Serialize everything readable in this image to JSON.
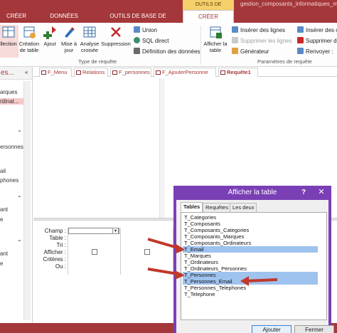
{
  "window": {
    "context_tab_header": "OUTILS DE REQUÊTE",
    "document_title": "gestion_composants_informatiques_ma"
  },
  "tabs": [
    {
      "label": "CRÉER"
    },
    {
      "label": "DONNÉES EXTERNES"
    },
    {
      "label": "OUTILS DE BASE DE DONNÉES"
    },
    {
      "label": "CRÉER"
    }
  ],
  "ribbon": {
    "buttons": [
      {
        "label": "llection"
      },
      {
        "label": "Création de table"
      },
      {
        "label": "Ajout"
      },
      {
        "label": "Mise à jour"
      },
      {
        "label": "Analyse croisée"
      },
      {
        "label": "Suppression"
      }
    ],
    "union": "Union",
    "sql_direct": "SQL direct",
    "data_definition": "Définition des données",
    "show_table": "Afficher la table",
    "insert_rows": "Insérer des lignes",
    "delete_rows": "Supprimer les lignes",
    "generator": "Générateur",
    "insert_cols": "Insérer des co",
    "delete_cols": "Supprimer de",
    "return": "Renvoyer :",
    "group_type": "Type de requête",
    "group_params": "Paramètres de requête"
  },
  "navpane": {
    "title": "es...",
    "items": [
      "arques",
      "rdinat...",
      "ersonnes",
      "ail",
      "phones",
      "ant",
      "e",
      "ant",
      "e"
    ]
  },
  "doc_tabs": [
    {
      "label": "F_Menu"
    },
    {
      "label": "Relations"
    },
    {
      "label": "F_personnes"
    },
    {
      "label": "F_AjouterPersonne"
    },
    {
      "label": "Requête1"
    }
  ],
  "grid": {
    "row_labels": [
      "Champ :",
      "Table :",
      "Tri :",
      "Afficher :",
      "Critères :",
      "Ou :"
    ]
  },
  "dialog": {
    "title": "Afficher la table",
    "help": "?",
    "close": "✕",
    "tabs": [
      "Tables",
      "Requêtes",
      "Les deux"
    ],
    "tables": [
      "T_Categories",
      "T_Composants",
      "T_Composants_Categories",
      "T_Composants_Marques",
      "T_Composants_Ordinateurs",
      "T_Email",
      "T_Marques",
      "T_Ordinateurs",
      "T_Ordinateurs_Personnes",
      "T_Personnes",
      "T_Personnes_Email",
      "T_Personnes_Telephones",
      "T_Telephone"
    ],
    "selected": [
      5,
      9,
      10
    ],
    "add_button": "Ajouter",
    "close_button": "Fermer"
  },
  "colors": {
    "accent": "#a4373a",
    "dialog_frame": "#7a3fb5",
    "selection": "#9fc3ef",
    "arrow": "#c0392b"
  }
}
